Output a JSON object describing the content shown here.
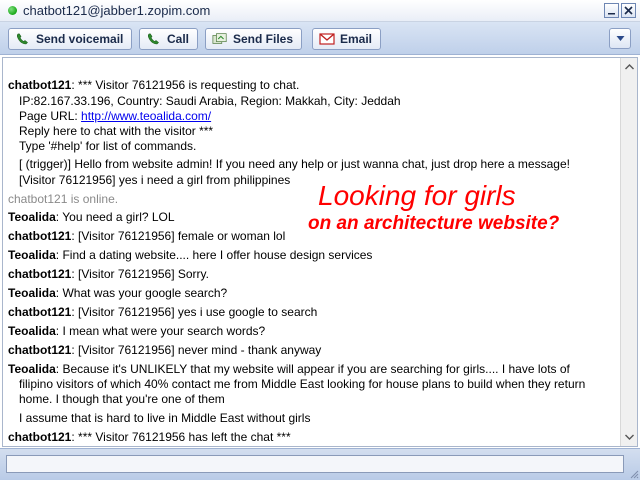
{
  "window": {
    "title": "chatbot121@jabber1.zopim.com"
  },
  "toolbar": {
    "send_voicemail": "Send voicemail",
    "call": "Call",
    "send_files": "Send Files",
    "email": "Email"
  },
  "colors": {
    "online_green": "#18a818",
    "overlay_red": "#ff0000",
    "link_blue": "#0000ee",
    "toolbar_blue": "#c6d5ec"
  },
  "chat": {
    "visitor_request": {
      "nick": "chatbot121",
      "text": ": *** Visitor 76121956 is requesting to chat.",
      "details": "IP:82.167.33.196, Country: Saudi Arabia, Region: Makkah, City: Jeddah",
      "page_url_label": "Page URL: ",
      "page_url": "http://www.teoalida.com/",
      "reply_hint": "Reply here to chat with the visitor ***",
      "help_hint": "Type '#help' for list of commands.",
      "trigger_msg": "[  (trigger)] Hello from website admin! If you need any help or just wanna chat, just drop here a message!",
      "visitor_msg": "[Visitor 76121956] yes i need a girl from philippines"
    },
    "online_status": "chatbot121 is online.",
    "messages": [
      {
        "nick": "Teoalida",
        "text": ": You need a girl? LOL"
      },
      {
        "nick": "chatbot121",
        "text": ": [Visitor 76121956] female or woman lol"
      },
      {
        "nick": "Teoalida",
        "text": ": Find a dating website.... here I offer house design services"
      },
      {
        "nick": "chatbot121",
        "text": ": [Visitor 76121956] Sorry."
      },
      {
        "nick": "Teoalida",
        "text": ": What was your google search?"
      },
      {
        "nick": "chatbot121",
        "text": ": [Visitor 76121956] yes i use google to search"
      },
      {
        "nick": "Teoalida",
        "text": ": I mean what were your search words?"
      },
      {
        "nick": "chatbot121",
        "text": ": [Visitor 76121956] never mind - thank anyway"
      },
      {
        "nick": "Teoalida",
        "text": ": Because it's UNLIKELY that my website will appear if you are searching for girls.... I have lots of",
        "cont": "filipino visitors of which 40% contact me from Middle East looking for house plans to build when they return",
        "cont2": "home. I though that you're one of them"
      },
      {
        "extra": "I assume that is hard to live in Middle East without girls"
      },
      {
        "nick": "chatbot121",
        "text": ": *** Visitor 76121956 has left the chat ***"
      }
    ]
  },
  "overlay": {
    "line1": "Looking for girls",
    "line2": "on an architecture website?"
  },
  "input": {
    "value": ""
  },
  "icons": {
    "phone": "phone-icon",
    "envelope": "envelope-icon",
    "files": "files-icon",
    "dropdown": "chevron-down-icon"
  }
}
